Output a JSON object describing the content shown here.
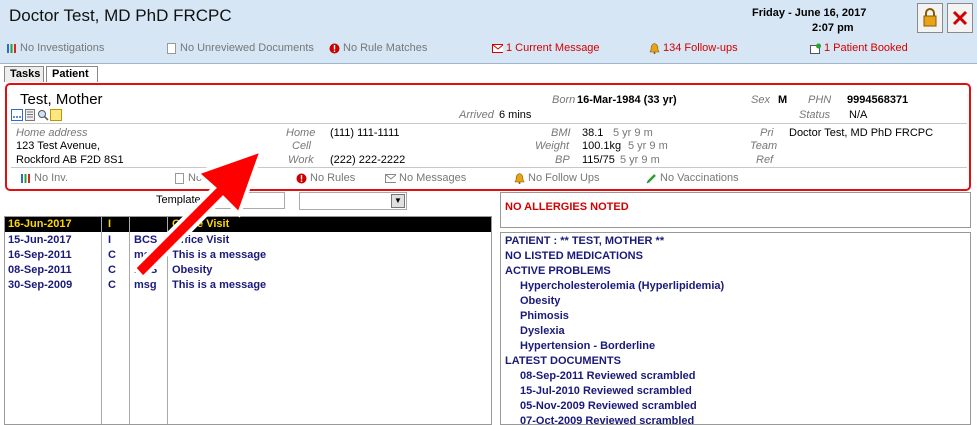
{
  "header": {
    "doctor_name": "Doctor Test, MD PhD FRCPC",
    "date": "Friday - June 16, 2017",
    "time": "2:07 pm"
  },
  "status": {
    "investigations": "No Investigations",
    "documents": "No Unreviewed Documents",
    "rules": "No Rule Matches",
    "messages": "1 Current Message",
    "followups": "134 Follow-ups",
    "booked": "1 Patient Booked"
  },
  "tabs": [
    {
      "label": "Tasks"
    },
    {
      "label": "Patient"
    }
  ],
  "patient": {
    "name": "Test, Mother",
    "born_label": "Born",
    "born_value": "16-Mar-1984 (33 yr)",
    "arrived_label": "Arrived",
    "arrived_value": "6 mins",
    "sex_label": "Sex",
    "sex_value": "M",
    "phn_label": "PHN",
    "phn_value": "9994568371",
    "status_label": "Status",
    "status_value": "N/A",
    "address_label": "Home address",
    "address_line1": "123 Test Avenue,",
    "address_line2": "Rockford AB  F2D 8S1",
    "home_label": "Home",
    "home_value": "(111) 111-1111",
    "cell_label": "Cell",
    "work_label": "Work",
    "work_value": "(222) 222-2222",
    "bmi_label": "BMI",
    "bmi_value": "38.1",
    "bmi_age": "5 yr 9 m",
    "weight_label": "Weight",
    "weight_value": "100.1kg",
    "weight_age": "5 yr 9 m",
    "bp_label": "BP",
    "bp_value": "115/75",
    "bp_age": "5 yr 9 m",
    "pri_label": "Pri",
    "pri_value": "Doctor Test, MD PhD FRCPC",
    "team_label": "Team",
    "ref_label": "Ref"
  },
  "patient_status": {
    "inv": "No Inv.",
    "docs": "No Docs",
    "rules": "No Rules",
    "messages": "No Messages",
    "followups": "No Follow Ups",
    "vaccinations": "No Vaccinations"
  },
  "templates": {
    "label": "Templates:"
  },
  "encounters": {
    "header": {
      "date": "16-Jun-2017",
      "type": "I",
      "code": "",
      "desc": "Office Visit"
    },
    "rows": [
      {
        "date": "15-Jun-2017",
        "type": "I",
        "code": "BCS",
        "desc": "Office Visit"
      },
      {
        "date": "16-Sep-2011",
        "type": "C",
        "code": "msg",
        "desc": "This is a message"
      },
      {
        "date": "08-Sep-2011",
        "type": "C",
        "code": "BCS",
        "desc": "Obesity"
      },
      {
        "date": "30-Sep-2009",
        "type": "C",
        "code": "msg",
        "desc": "This is a message"
      }
    ]
  },
  "allergies": "NO ALLERGIES NOTED",
  "summary": {
    "patient_line": "PATIENT : ** TEST, MOTHER **",
    "medications": "NO LISTED MEDICATIONS",
    "active_problems_title": "ACTIVE PROBLEMS",
    "problems": [
      "Hypercholesterolemia (Hyperlipidemia)",
      "Obesity",
      "Phimosis",
      "Dyslexia",
      "Hypertension - Borderline"
    ],
    "latest_docs_title": "LATEST DOCUMENTS",
    "documents": [
      "08-Sep-2011 Reviewed scrambled",
      "15-Jul-2010 Reviewed scrambled",
      "05-Nov-2009 Reviewed scrambled",
      "07-Oct-2009 Reviewed scrambled"
    ]
  },
  "colors": {
    "header_bg": "#d6e6f4",
    "highlight_red": "#e01010",
    "alert_red": "#d40000",
    "navy_text": "#1a1a7a",
    "header_yellow": "#ffd700"
  }
}
